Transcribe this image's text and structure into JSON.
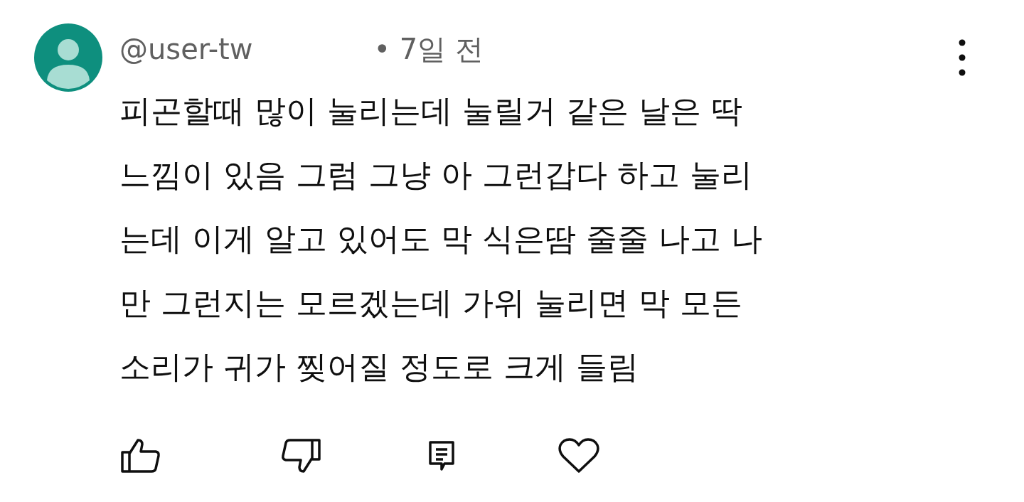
{
  "comment": {
    "author": "@user-tw",
    "time": "• 7일 전",
    "lines": [
      "피곤할때 많이 눌리는데 눌릴거 같은 날은 딱",
      "느낌이 있음 그럼 그냥 아 그런갑다 하고 눌리",
      "는데 이게 알고 있어도 막 식은땀 줄줄 나고 나",
      "만 그런지는 모르겠는데 가위 눌리면 막 모든",
      "소리가 귀가 찢어질 정도로 크게 들림"
    ],
    "liked": false,
    "disliked": false,
    "hearted": false
  }
}
